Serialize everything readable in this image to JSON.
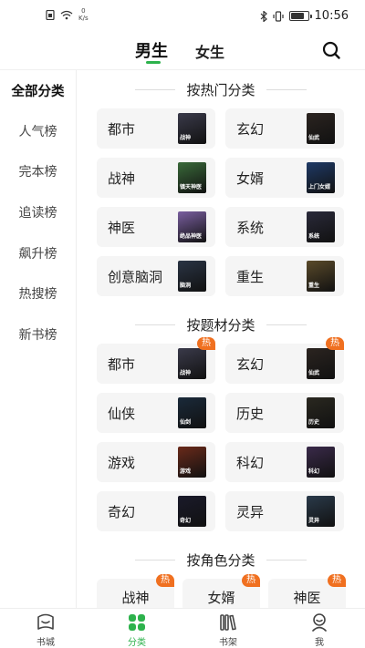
{
  "status_bar": {
    "speed_value": "0",
    "speed_unit": "K/s",
    "time": "10:56",
    "battery_level": 0.85
  },
  "header": {
    "tabs": [
      {
        "label": "男生",
        "active": true
      },
      {
        "label": "女生",
        "active": false
      }
    ],
    "search_icon": "search-icon"
  },
  "sidebar": {
    "items": [
      {
        "label": "全部分类",
        "active": true
      },
      {
        "label": "人气榜",
        "active": false
      },
      {
        "label": "完本榜",
        "active": false
      },
      {
        "label": "追读榜",
        "active": false
      },
      {
        "label": "飙升榜",
        "active": false
      },
      {
        "label": "热搜榜",
        "active": false
      },
      {
        "label": "新书榜",
        "active": false
      }
    ]
  },
  "sections": {
    "hot": {
      "title": "按热门分类",
      "items": [
        {
          "label": "都市",
          "cover_text": "战神",
          "cover_color": "#3a3a4a"
        },
        {
          "label": "玄幻",
          "cover_text": "仙武",
          "cover_color": "#2b2420"
        },
        {
          "label": "战神",
          "cover_text": "镇天神医",
          "cover_color": "#3a6a3a"
        },
        {
          "label": "女婿",
          "cover_text": "上门女婿",
          "cover_color": "#1f3a66"
        },
        {
          "label": "神医",
          "cover_text": "绝品神医",
          "cover_color": "#7a5fa0"
        },
        {
          "label": "系统",
          "cover_text": "系统",
          "cover_color": "#2a2a3a"
        },
        {
          "label": "创意脑洞",
          "cover_text": "脑洞",
          "cover_color": "#2a3444"
        },
        {
          "label": "重生",
          "cover_text": "重生",
          "cover_color": "#5a4a2a"
        }
      ]
    },
    "theme": {
      "title": "按题材分类",
      "items": [
        {
          "label": "都市",
          "hot": true,
          "badge": "热",
          "cover_text": "战神",
          "cover_color": "#3a3a4a"
        },
        {
          "label": "玄幻",
          "hot": true,
          "badge": "热",
          "cover_text": "仙武",
          "cover_color": "#2b2420"
        },
        {
          "label": "仙侠",
          "hot": false,
          "badge": "",
          "cover_text": "仙剑",
          "cover_color": "#1a2a3a"
        },
        {
          "label": "历史",
          "hot": false,
          "badge": "",
          "cover_text": "历史",
          "cover_color": "#2a2820"
        },
        {
          "label": "游戏",
          "hot": false,
          "badge": "",
          "cover_text": "游戏",
          "cover_color": "#6a2a1a"
        },
        {
          "label": "科幻",
          "hot": false,
          "badge": "",
          "cover_text": "科幻",
          "cover_color": "#3a2a4a"
        },
        {
          "label": "奇幻",
          "hot": false,
          "badge": "",
          "cover_text": "奇幻",
          "cover_color": "#1a1a2a"
        },
        {
          "label": "灵异",
          "hot": false,
          "badge": "",
          "cover_text": "灵异",
          "cover_color": "#2a3a4a"
        }
      ]
    },
    "role": {
      "title": "按角色分类",
      "items": [
        {
          "label": "战神",
          "badge": "热"
        },
        {
          "label": "女婿",
          "badge": "热"
        },
        {
          "label": "神医",
          "badge": "热"
        }
      ]
    }
  },
  "bottom_nav": {
    "items": [
      {
        "label": "书城",
        "icon": "bookstore-icon",
        "active": false
      },
      {
        "label": "分类",
        "icon": "category-icon",
        "active": true
      },
      {
        "label": "书架",
        "icon": "bookshelf-icon",
        "active": false
      },
      {
        "label": "我",
        "icon": "profile-icon",
        "active": false
      }
    ]
  },
  "colors": {
    "accent": "#2db24c",
    "hot_badge": "#f07020",
    "card_bg": "#f5f5f5"
  }
}
